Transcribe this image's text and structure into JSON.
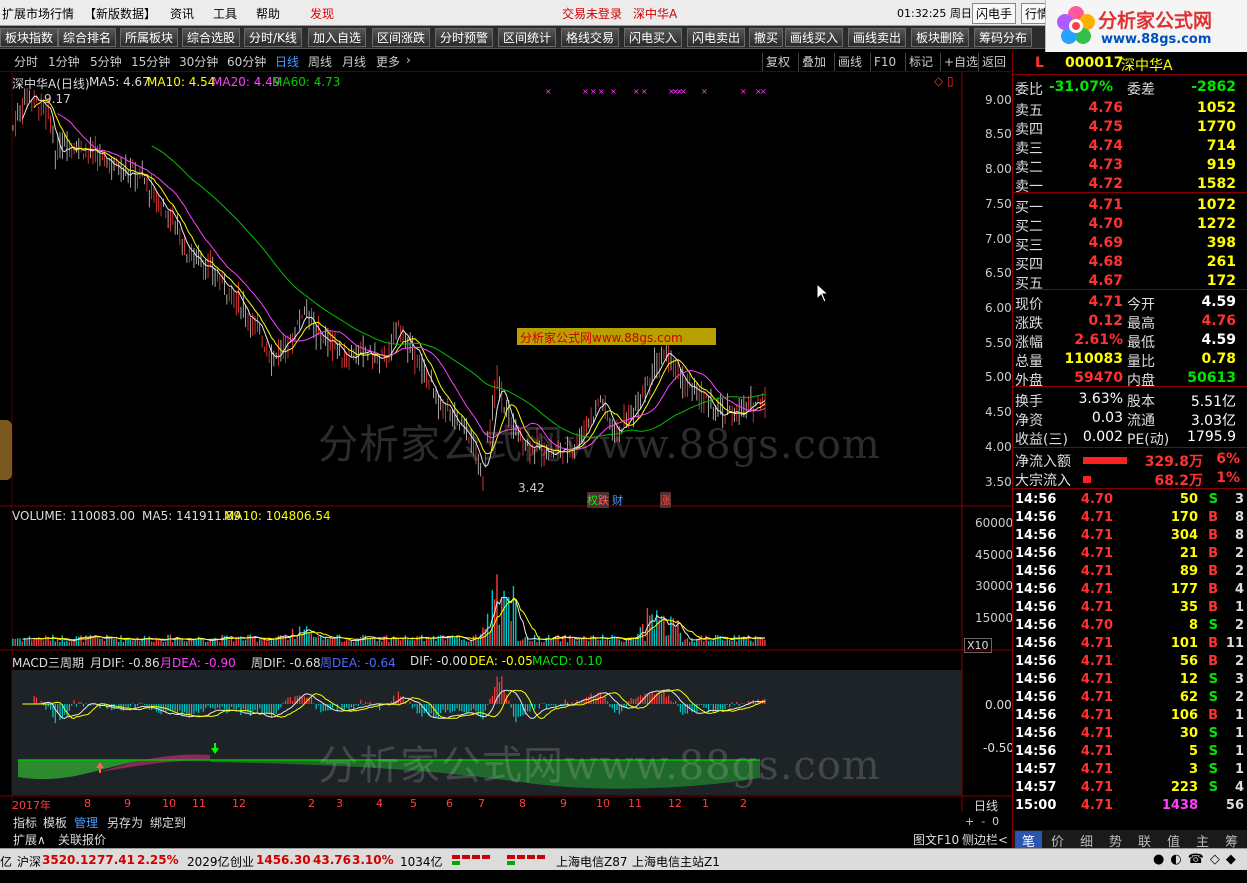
{
  "menubar": {
    "items": [
      "扩展市场行情",
      "【新版数据】",
      "资讯",
      "工具",
      "帮助",
      "发现"
    ],
    "login_status": "交易未登录",
    "stock_name": "深中华A",
    "time": "01:32:25 周日",
    "flash_btn": "闪电手",
    "quote_btn": "行情"
  },
  "logo": {
    "title": "分析家公式网",
    "url": "www.88gs.com"
  },
  "toolbar": [
    "板块指数",
    "综合排名",
    "所属板块",
    "综合选股",
    "分时/K线",
    "加入自选",
    "区间涨跌",
    "分时预警",
    "区间统计",
    "格线交易",
    "闪电买入",
    "闪电卖出",
    "撤买",
    "画线买入",
    "画线卖出",
    "板块删除",
    "筹码分布"
  ],
  "periods": [
    "分时",
    "1分钟",
    "5分钟",
    "15分钟",
    "30分钟",
    "60分钟",
    "日线",
    "周线",
    "月线",
    "更多"
  ],
  "active_period": "日线",
  "chart_buttons": [
    "复权",
    "叠加",
    "画线",
    "F10",
    "标记",
    "+自选",
    "返回"
  ],
  "main_chart": {
    "title": "深中华A(日线)",
    "ma5": "MA5: 4.67",
    "ma10": "MA10: 4.54",
    "ma20": "MA20: 4.49",
    "ma60": "MA60: 4.73",
    "high_label": "9.17",
    "low_label": "3.42",
    "banner": "分析家公式网www.88gs.com",
    "markers": [
      "权",
      "跌",
      "财",
      "涨"
    ],
    "y_ticks": [
      "9.00",
      "8.50",
      "8.00",
      "7.50",
      "7.00",
      "6.50",
      "6.00",
      "5.50",
      "5.00",
      "4.50",
      "4.00",
      "3.50"
    ]
  },
  "volume_chart": {
    "title": "VOLUME: 110083.00",
    "ma5": "MA5: 141911.89",
    "ma10": "MA10: 104806.54",
    "y_ticks": [
      "60000",
      "45000",
      "30000",
      "15000"
    ],
    "unit": "X10"
  },
  "macd_chart": {
    "title": "MACD三周期",
    "month_dif": "月DIF: -0.86",
    "month_dea": "月DEA: -0.90",
    "week_dif": "周DIF: -0.68",
    "week_dea": "周DEA: -0.64",
    "dif": "DIF: -0.00",
    "dea": "DEA: -0.05",
    "macd": "MACD: 0.10",
    "y_ticks": [
      "0.00",
      "-0.50"
    ]
  },
  "x_axis": [
    "2017年",
    "8",
    "9",
    "10",
    "11",
    "12",
    "2",
    "3",
    "4",
    "5",
    "6",
    "7",
    "8",
    "9",
    "10",
    "11",
    "12",
    "1",
    "2"
  ],
  "x_axis_right": "日线",
  "bottom_tabs": [
    "指标",
    "模板",
    "管理",
    "另存为",
    "绑定到"
  ],
  "bottom_tabs2": [
    "扩展∧",
    "关联报价"
  ],
  "bottom_right": [
    "图文F10",
    "侧边栏<"
  ],
  "quote": {
    "code": "000017",
    "name": "深中华A",
    "wb_label": "委比",
    "wb": "-31.07%",
    "wc_label": "委差",
    "wc": "-2862",
    "asks": [
      {
        "label": "卖五",
        "price": "4.76",
        "vol": "1052"
      },
      {
        "label": "卖四",
        "price": "4.75",
        "vol": "1770"
      },
      {
        "label": "卖三",
        "price": "4.74",
        "vol": "714"
      },
      {
        "label": "卖二",
        "price": "4.73",
        "vol": "919"
      },
      {
        "label": "卖一",
        "price": "4.72",
        "vol": "1582"
      }
    ],
    "bids": [
      {
        "label": "买一",
        "price": "4.71",
        "vol": "1072"
      },
      {
        "label": "买二",
        "price": "4.70",
        "vol": "1272"
      },
      {
        "label": "买三",
        "price": "4.69",
        "vol": "398"
      },
      {
        "label": "买四",
        "price": "4.68",
        "vol": "261"
      },
      {
        "label": "买五",
        "price": "4.67",
        "vol": "172"
      }
    ],
    "stats": [
      {
        "l1": "现价",
        "v1": "4.71",
        "l2": "今开",
        "v2": "4.59"
      },
      {
        "l1": "涨跌",
        "v1": "0.12",
        "l2": "最高",
        "v2": "4.76"
      },
      {
        "l1": "涨幅",
        "v1": "2.61%",
        "l2": "最低",
        "v2": "4.59"
      },
      {
        "l1": "总量",
        "v1": "110083",
        "l2": "量比",
        "v2": "0.78"
      },
      {
        "l1": "外盘",
        "v1": "59470",
        "l2": "内盘",
        "v2": "50613"
      }
    ],
    "fund": [
      {
        "l1": "换手",
        "v1": "3.63%",
        "l2": "股本",
        "v2": "5.51亿"
      },
      {
        "l1": "净资",
        "v1": "0.03",
        "l2": "流通",
        "v2": "3.03亿"
      },
      {
        "l1": "收益(三)",
        "v1": "0.002",
        "l2": "PE(动)",
        "v2": "1795.9"
      }
    ],
    "flow": [
      {
        "label": "净流入额",
        "value": "329.8万",
        "pct": "6%"
      },
      {
        "label": "大宗流入",
        "value": "68.2万",
        "pct": "1%"
      }
    ],
    "ticks": [
      {
        "t": "14:56",
        "p": "4.70",
        "v": "50",
        "d": "S",
        "n": "3"
      },
      {
        "t": "14:56",
        "p": "4.71",
        "v": "170",
        "d": "B",
        "n": "8"
      },
      {
        "t": "14:56",
        "p": "4.71",
        "v": "304",
        "d": "B",
        "n": "8"
      },
      {
        "t": "14:56",
        "p": "4.71",
        "v": "21",
        "d": "B",
        "n": "2"
      },
      {
        "t": "14:56",
        "p": "4.71",
        "v": "89",
        "d": "B",
        "n": "2"
      },
      {
        "t": "14:56",
        "p": "4.71",
        "v": "177",
        "d": "B",
        "n": "4"
      },
      {
        "t": "14:56",
        "p": "4.71",
        "v": "35",
        "d": "B",
        "n": "1"
      },
      {
        "t": "14:56",
        "p": "4.70",
        "v": "8",
        "d": "S",
        "n": "2"
      },
      {
        "t": "14:56",
        "p": "4.71",
        "v": "101",
        "d": "B",
        "n": "11"
      },
      {
        "t": "14:56",
        "p": "4.71",
        "v": "56",
        "d": "B",
        "n": "2"
      },
      {
        "t": "14:56",
        "p": "4.71",
        "v": "12",
        "d": "S",
        "n": "3"
      },
      {
        "t": "14:56",
        "p": "4.71",
        "v": "62",
        "d": "S",
        "n": "2"
      },
      {
        "t": "14:56",
        "p": "4.71",
        "v": "106",
        "d": "B",
        "n": "1"
      },
      {
        "t": "14:56",
        "p": "4.71",
        "v": "30",
        "d": "S",
        "n": "1"
      },
      {
        "t": "14:56",
        "p": "4.71",
        "v": "5",
        "d": "S",
        "n": "1"
      },
      {
        "t": "14:57",
        "p": "4.71",
        "v": "3",
        "d": "S",
        "n": "1"
      },
      {
        "t": "14:57",
        "p": "4.71",
        "v": "223",
        "d": "S",
        "n": "4"
      },
      {
        "t": "15:00",
        "p": "4.71",
        "v": "1438",
        "d": "",
        "n": "56"
      }
    ],
    "bottom_tabs": [
      "笔",
      "价",
      "细",
      "势",
      "联",
      "值",
      "主",
      "筹"
    ]
  },
  "status": {
    "sh_label": "沪深",
    "sh_val": "3520.12",
    "sh_chg": "77.41",
    "sh_pct": "2.25%",
    "sh_amt": "2029亿",
    "cy_label": "创业",
    "cy_val": "1456.30",
    "cy_chg": "43.76",
    "cy_pct": "3.10%",
    "cy_amt": "1034亿",
    "server1": "上海电信Z87",
    "server2": "上海电信主站Z1"
  },
  "watermark": "分析家公式网www.88gs.com"
}
